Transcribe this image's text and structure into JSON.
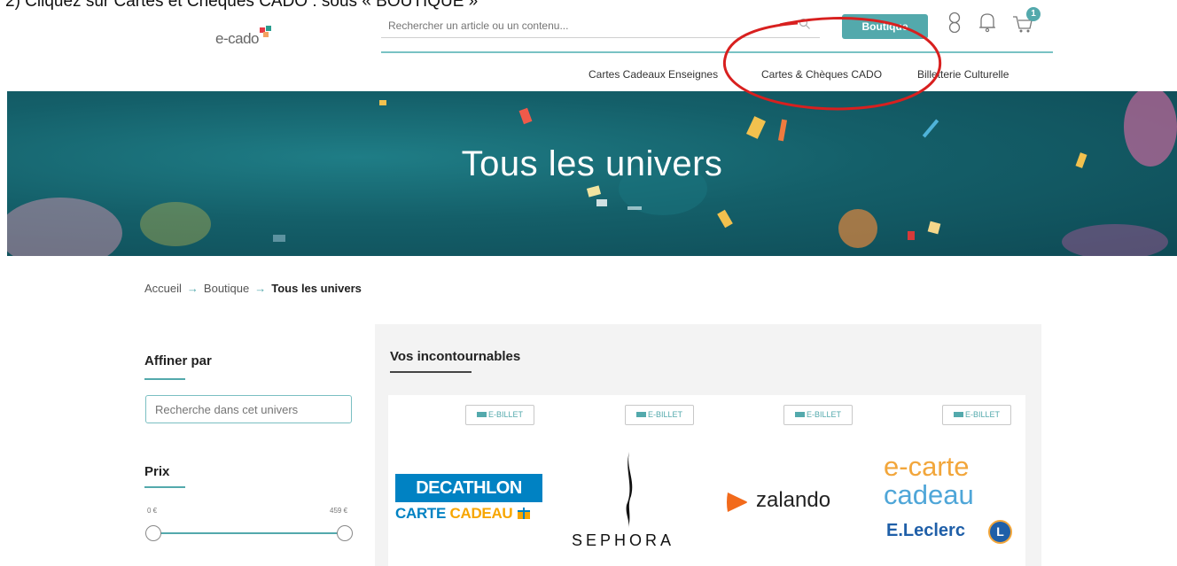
{
  "instruction": "2) Cliquez sur Cartes et Chèques CADO : sous « BOUTIQUE »",
  "header": {
    "logo_text": "e-cado",
    "search_placeholder": "Rechercher un article ou un contenu...",
    "boutique_label": "Boutique",
    "cart_count": "1"
  },
  "nav": {
    "items": [
      {
        "label": "Cartes Cadeaux Enseignes"
      },
      {
        "label": "Cartes & Chèques CADO"
      },
      {
        "label": "Billetterie Culturelle"
      }
    ]
  },
  "hero": {
    "title": "Tous les univers"
  },
  "breadcrumb": {
    "home": "Accueil",
    "shop": "Boutique",
    "current": "Tous les univers"
  },
  "sidebar": {
    "refine_title": "Affiner par",
    "search_placeholder": "Recherche dans cet univers",
    "price_title": "Prix",
    "price_min": "0 €",
    "price_max": "459 €",
    "price_range_fraction": [
      0,
      1
    ]
  },
  "main": {
    "section_title": "Vos incontournables",
    "products": [
      {
        "badge": "E-BILLET",
        "brand": "Decathlon",
        "logo_line1": "DECATHLON",
        "logo_line2a": "CARTE ",
        "logo_line2b": "CADEAU"
      },
      {
        "badge": "E-BILLET",
        "brand": "Sephora",
        "logo_text": "SEPHORA"
      },
      {
        "badge": "E-BILLET",
        "brand": "Zalando",
        "logo_text": "zalando"
      },
      {
        "badge": "E-BILLET",
        "brand": "E.Leclerc",
        "logo_line1": "e-carte",
        "logo_line2": "cadeau",
        "logo_line3": "E.Leclerc",
        "logo_badge": "L"
      }
    ]
  },
  "colors": {
    "accent": "#53a9ac",
    "hero_bg": "#145f69",
    "annotation": "#d8201f"
  }
}
